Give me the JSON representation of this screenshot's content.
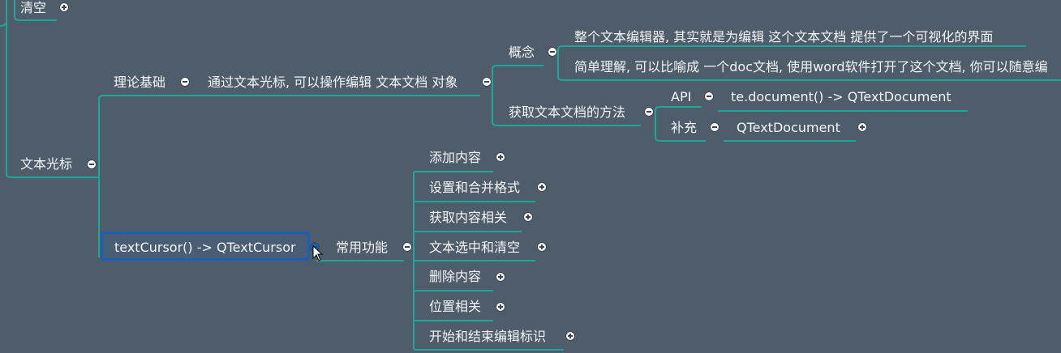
{
  "nodes": {
    "qingkong": "清空",
    "wenben_guangbiao": "文本光标",
    "lilun_jichu": "理论基础",
    "tongguo": "通过文本光标, 可以操作编辑 文本文档 对象",
    "gainian": "概念",
    "gainian_1": "整个文本编辑器, 其实就是为编辑 这个文本文档 提供了一个可视化的界面",
    "gainian_2": "简单理解, 可以比喻成 一个doc文档, 使用word软件打开了这个文档, 你可以随意编",
    "huoqu_fangfa": "获取文本文档的方法",
    "api": "API",
    "api_value": "te.document() -> QTextDocument",
    "buchong": "补充",
    "buchong_value": "QTextDocument",
    "text_cursor": "textCursor() -> QTextCursor",
    "changyong": "常用功能",
    "items": [
      "添加内容",
      "设置和合并格式",
      "获取内容相关",
      "文本选中和清空",
      "删除内容",
      "位置相关",
      "开始和结束编辑标识"
    ]
  },
  "colors": {
    "background": "#4f5d6b",
    "branch": "#1aa89a",
    "selection": "#1d5fb8",
    "text": "#f2f4f6"
  }
}
